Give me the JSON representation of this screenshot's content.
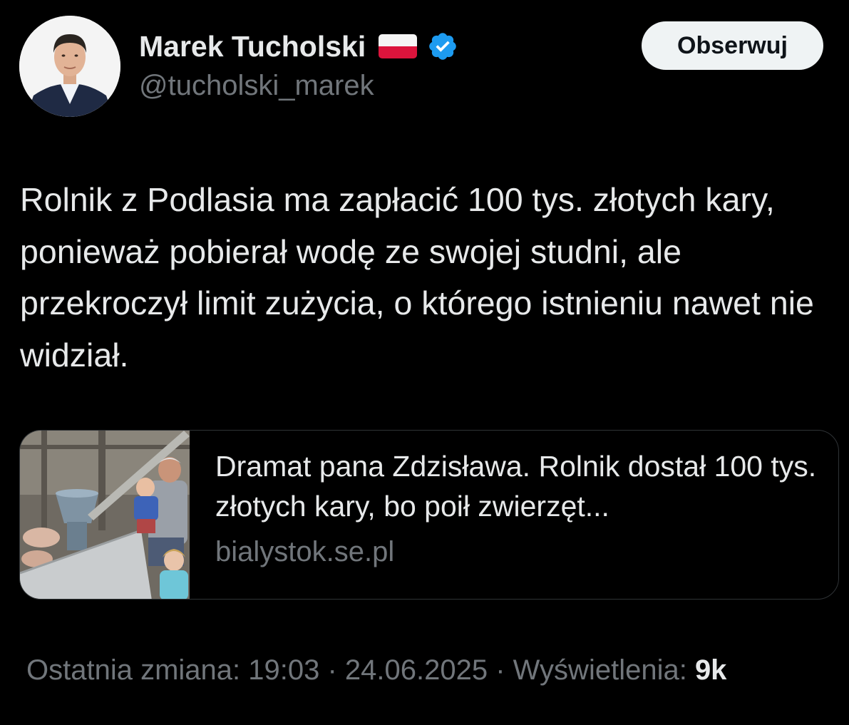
{
  "author": {
    "display_name": "Marek Tucholski",
    "handle": "@tucholski_marek",
    "flag_icon": "poland-flag-icon",
    "verified_icon": "verified-badge-icon",
    "verified_color": "#1d9bf0"
  },
  "follow_button": {
    "label": "Obserwuj"
  },
  "tweet": {
    "text": "Rolnik z Podlasia ma zapłacić 100 tys. złotych kary, ponieważ pobierał wodę ze swojej studni, ale przekroczył limit zużycia, o którego istnieniu nawet nie widział."
  },
  "link_card": {
    "title": "Dramat pana Zdzisława. Rolnik dostał 100 tys. złotych kary, bo poił zwierzęt...",
    "domain": "bialystok.se.pl"
  },
  "meta": {
    "edited_label": "Ostatnia zmiana: 19:03 · 24.06.2025",
    "views_label": "· Wyświetlenia:",
    "views_count": "9k"
  },
  "colors": {
    "background": "#000000",
    "primary_text": "#e7e9ea",
    "secondary_text": "#71767b",
    "border": "#2f3336",
    "button_bg": "#eff3f4"
  }
}
